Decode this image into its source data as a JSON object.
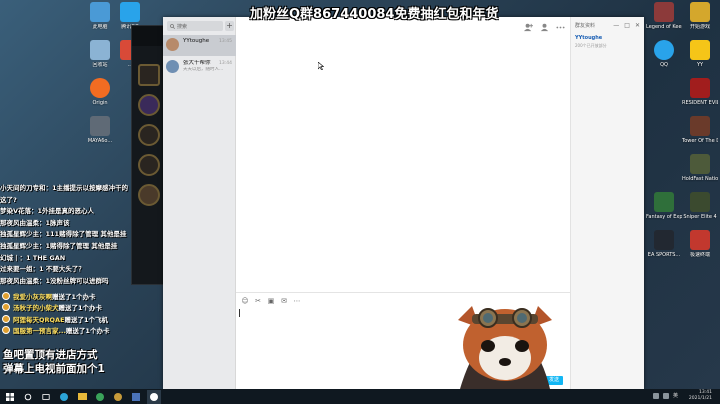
{
  "overlay": {
    "banner": "加粉丝Q群867440084免费抽红包和年货",
    "danmaku": [
      "小天间的刀专和：1主播提示以按摩感冲干的",
      "这了?",
      "梦染V花落：1外挂是真的恶心人",
      "那夜风由温柔：1脉声该",
      "独孤星辉少主：111赌得除了管理 其他是挂",
      "独孤星辉少主：1赌得除了管理 其他是挂",
      "幻城丨：1 THE GAN",
      "过来要一姐：1 不要大头了？",
      "那夜风由温柔：1没粉丝牌可以进群吗"
    ],
    "gifts": [
      {
        "user": "我爱小灰灰啊",
        "text": "赠送了1个办卡"
      },
      {
        "user": "汤秋子的小柴犬",
        "text": "赠送了1个办卡"
      },
      {
        "user": "阿狸每天QRQAE",
        "text": "赠送了1个飞机"
      },
      {
        "user": "国服第一预言家...",
        "text": "赠送了1个办卡"
      }
    ],
    "notice": [
      "鱼吧置顶有进店方式",
      "弹幕上电视前面加个1"
    ]
  },
  "desktop_left": [
    {
      "label": "此电脑",
      "color": "#4a9ad6"
    },
    {
      "label": "腾讯QQ",
      "color": "#29a3ea"
    },
    {
      "label": "回收站",
      "color": "#8bb3d4"
    },
    {
      "label": "...",
      "color": "#d84a38"
    },
    {
      "label": "Origin",
      "color": "#f26c22"
    },
    {
      "label": "MAYA6o...",
      "color": "#5f6a76"
    }
  ],
  "desktop_right": [
    {
      "label": "Legend of Keepers...",
      "color": "#8c3a3a"
    },
    {
      "label": "开始游戏",
      "color": "#d4a72c"
    },
    {
      "label": "QQ",
      "color": "#29a3ea"
    },
    {
      "label": "YY",
      "color": "#f5c518"
    },
    {
      "label": "RESIDENT EVIL 3",
      "color": "#a11d1d"
    },
    {
      "label": "Tower Of The Dead...",
      "color": "#6a3a2a"
    },
    {
      "label": "HoldFast Nations...",
      "color": "#4d5a3a"
    },
    {
      "label": "Sniper Elite 4",
      "color": "#3b4a2f"
    },
    {
      "label": "Fantasy of Expediti...",
      "color": "#2f6f3a"
    },
    {
      "label": "EA SPORTS...",
      "color": "#222831"
    },
    {
      "label": "极速终端",
      "color": "#c2382e"
    }
  ],
  "messenger": {
    "search_placeholder": "搜索",
    "add": "+",
    "contacts": [
      {
        "name": "YYtoughe",
        "preview": "",
        "time": "13:45",
        "avatar": "#b78a6a",
        "active": true
      },
      {
        "name": "张大千帮你",
        "preview": "天天以后，随时人...",
        "time": "13:44",
        "avatar": "#6f8fb3",
        "active": false
      }
    ],
    "group_info": {
      "title": "群友资料",
      "min": "—",
      "max": "□",
      "close": "✕",
      "name": "YYtoughe",
      "subtitle": "200个已开放部分"
    },
    "toolbar": [
      "☺",
      "✂",
      "▣",
      "✉",
      "⋯"
    ],
    "input_value": "",
    "send_label": "发送"
  },
  "tray": {
    "time": "13:41",
    "date": "2021/1/21",
    "lang": "英"
  },
  "colors": {
    "accent": "#12b7f5",
    "gift_user": "#ffdf5d"
  }
}
